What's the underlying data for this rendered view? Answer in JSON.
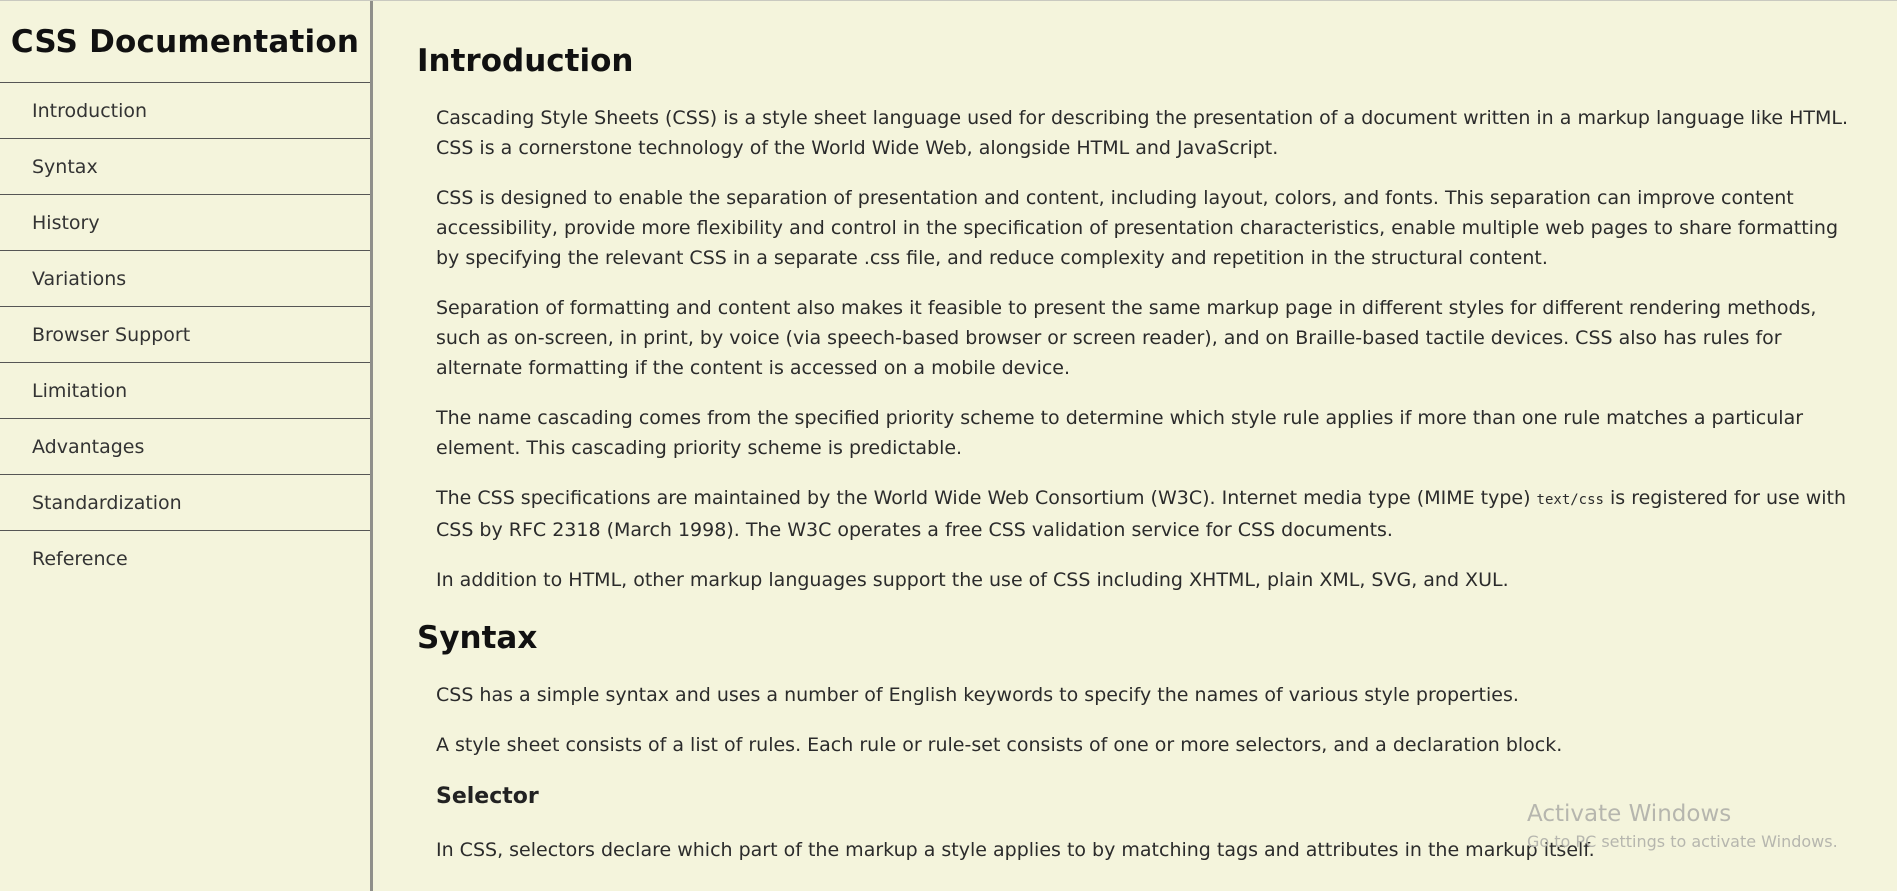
{
  "sidebar": {
    "title": "CSS Documentation",
    "items": [
      {
        "label": "Introduction"
      },
      {
        "label": "Syntax"
      },
      {
        "label": "History"
      },
      {
        "label": "Variations"
      },
      {
        "label": "Browser Support"
      },
      {
        "label": "Limitation"
      },
      {
        "label": "Advantages"
      },
      {
        "label": "Standardization"
      },
      {
        "label": "Reference"
      }
    ]
  },
  "main": {
    "introduction": {
      "title": "Introduction",
      "p1": "Cascading Style Sheets (CSS) is a style sheet language used for describing the presentation of a document written in a markup language like HTML. CSS is a cornerstone technology of the World Wide Web, alongside HTML and JavaScript.",
      "p2": "CSS is designed to enable the separation of presentation and content, including layout, colors, and fonts. This separation can improve content accessibility, provide more flexibility and control in the specification of presentation characteristics, enable multiple web pages to share formatting by specifying the relevant CSS in a separate .css file, and reduce complexity and repetition in the structural content.",
      "p3": "Separation of formatting and content also makes it feasible to present the same markup page in different styles for different rendering methods, such as on-screen, in print, by voice (via speech-based browser or screen reader), and on Braille-based tactile devices. CSS also has rules for alternate formatting if the content is accessed on a mobile device.",
      "p4": "The name cascading comes from the specified priority scheme to determine which style rule applies if more than one rule matches a particular element. This cascading priority scheme is predictable.",
      "p5_before": "The CSS specifications are maintained by the World Wide Web Consortium (W3C). Internet media type (MIME type) ",
      "p5_code": "text/css",
      "p5_after": " is registered for use with CSS by RFC 2318 (March 1998). The W3C operates a free CSS validation service for CSS documents.",
      "p6": "In addition to HTML, other markup languages support the use of CSS including XHTML, plain XML, SVG, and XUL."
    },
    "syntax": {
      "title": "Syntax",
      "p1": "CSS has a simple syntax and uses a number of English keywords to specify the names of various style properties.",
      "p2": "A style sheet consists of a list of rules. Each rule or rule-set consists of one or more selectors, and a declaration block.",
      "selector_title": "Selector",
      "p3": "In CSS, selectors declare which part of the markup a style applies to by matching tags and attributes in the markup itself."
    }
  },
  "watermark": {
    "line1": "Activate Windows",
    "line2": "Go to PC settings to activate Windows."
  }
}
